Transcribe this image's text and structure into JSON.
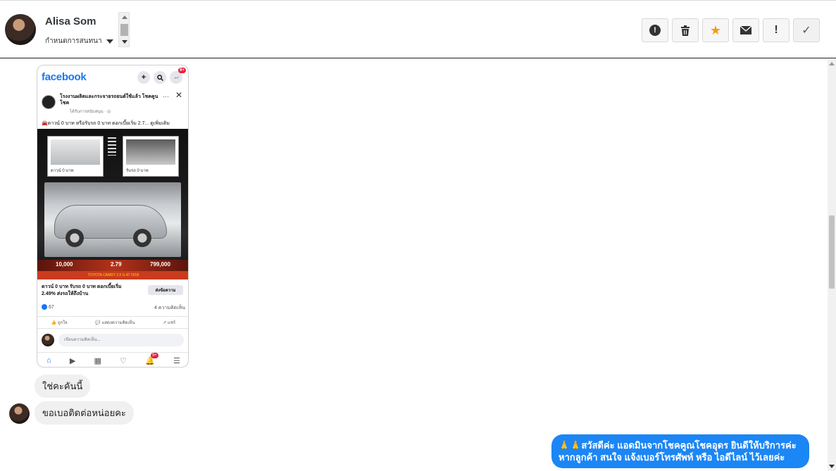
{
  "header": {
    "contact_name": "Alisa Som",
    "conversation_label": "กำหนดการสนทนา"
  },
  "actions": {
    "report_icon": "!",
    "delete_icon": "🗑",
    "star_icon": "★",
    "mail_icon": "✉",
    "important_icon": "!",
    "check_icon": "✓",
    "star_color": "#f39c12"
  },
  "phone": {
    "logo": "facebook",
    "messenger_badge": "9+",
    "page_name": "โรงงานผลิตและกระจายรถยนต์ใช้แล้ว โชคคูนโชค",
    "page_sub": "ได้รับการสนับสนุน · ◎",
    "post_text": "🚘ดาวน์ 0 บาท หรือรับรถ 0 บาท ดอกเบี้ยเริ่ม 2.7... ดูเพิ่มเติม",
    "thumb1_caption": "ดาวน์ 0 บาท",
    "thumb2_caption": "รับรถ 0 บาท",
    "price1": "10,000",
    "price2": "2.79",
    "price3": "799,000",
    "price_footer": "TOYOTA CAMRY 2.0 G AT 2018",
    "cta_line1": "ดาวน์ 0 บาท รับรถ 0 บาท ดอกเบี้ยเริ่ม",
    "cta_line2": "2.49% ส่งรถให้ถึงบ้าน",
    "cta_button": "ส่งข้อความ",
    "reactions": "67",
    "comments_count": "4 ความคิดเห็น",
    "like_label": "ถูกใจ",
    "comment_label": "แสดงความคิดเห็น",
    "share_label": "แชร์",
    "comment_placeholder": "เขียนความคิดเห็น...",
    "notif_badge": "9+"
  },
  "messages": {
    "m1": "ใช่คะคันนี้",
    "m2": "ขอเบอติดต่อหน่อยคะ",
    "reply_line1": "🙏🙏สวัสดีค่ะ แอดมินจากโชคคูณโชคอุดร ยินดีให้บริการค่ะ",
    "reply_line2": "หากลูกค้า สนใจ แจ้งเบอร์โทรศัพท์ หรือ ไอดีไลน์  ไว้เลยค่ะ"
  }
}
